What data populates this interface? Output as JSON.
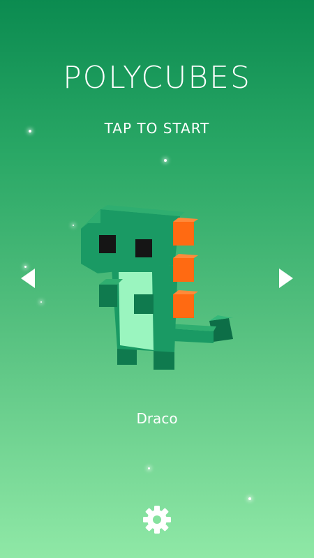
{
  "game": {
    "title": "POLYCUBES",
    "prompt": "TAP TO START",
    "character_name": "Draco"
  },
  "icons": {
    "prev": "chevron-left-triangle",
    "next": "chevron-right-triangle",
    "settings": "gear-icon"
  },
  "colors": {
    "background_top": "#0b8b50",
    "background_bottom": "#8fe8a6",
    "dino_body": "#1a9a64",
    "dino_belly": "#9af5bf",
    "dino_spikes": "#ff6a12",
    "dino_eyes": "#151515"
  }
}
